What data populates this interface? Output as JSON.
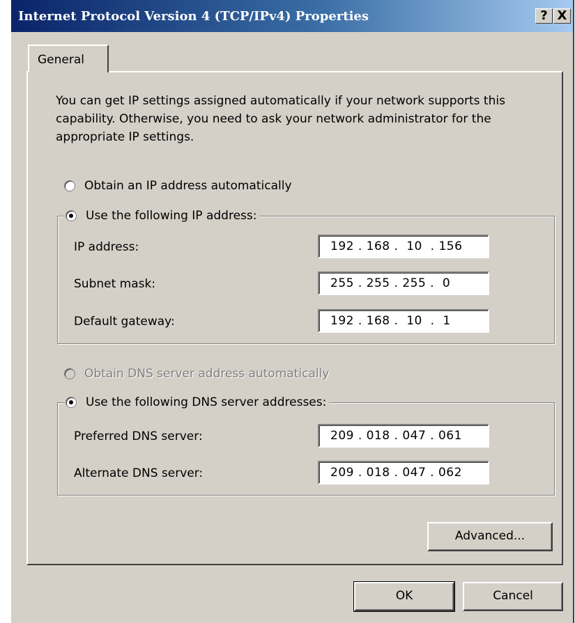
{
  "window": {
    "title": "Internet Protocol Version 4 (TCP/IPv4) Properties",
    "help_glyph": "?",
    "close_glyph": "X"
  },
  "tabs": [
    {
      "label": "General",
      "active": true
    }
  ],
  "intro_text": "You can get IP settings assigned automatically if your network supports this capability. Otherwise, you need to ask your network administrator for the appropriate IP settings.",
  "ip_section": {
    "auto_label": "Obtain an IP address automatically",
    "manual_label": "Use the following IP address:",
    "selected": "manual",
    "fields": [
      {
        "label": "IP address:",
        "value": "192 . 168 .  10  . 156"
      },
      {
        "label": "Subnet mask:",
        "value": "255 . 255 . 255 .  0"
      },
      {
        "label": "Default gateway:",
        "value": "192 . 168 .  10  .  1"
      }
    ]
  },
  "dns_section": {
    "auto_label": "Obtain DNS server address automatically",
    "auto_disabled": true,
    "manual_label": "Use the following DNS server addresses:",
    "selected": "manual",
    "fields": [
      {
        "label": "Preferred DNS server:",
        "value": "209 . 018 . 047 . 061"
      },
      {
        "label": "Alternate DNS server:",
        "value": "209 . 018 . 047 . 062"
      }
    ]
  },
  "buttons": {
    "advanced": "Advanced...",
    "ok": "OK",
    "cancel": "Cancel"
  },
  "colors": {
    "dialog_bg": "#d4d0c8",
    "titlebar_start": "#0a246a",
    "titlebar_end": "#a6caf0"
  }
}
